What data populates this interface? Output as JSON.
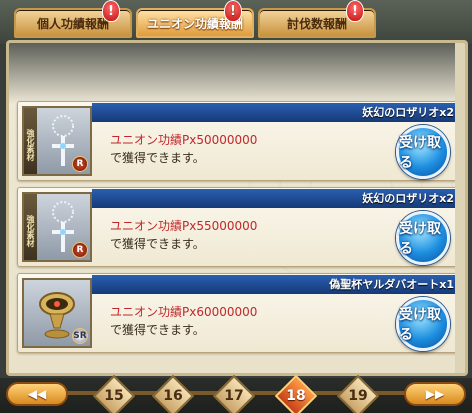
{
  "tabs": [
    {
      "label": "個人功績報酬",
      "active": false,
      "alert": true
    },
    {
      "label": "ユニオン功績報酬",
      "active": true,
      "alert": true
    },
    {
      "label": "討伐数報酬",
      "active": false,
      "alert": true
    }
  ],
  "alert_mark": "!",
  "rewards": [
    {
      "title": "妖幻のロザリオx2",
      "material_tag": "強化素材",
      "rarity": "R",
      "condition": "ユニオン功績Px50000000",
      "description": "で獲得できます。",
      "button": "受け取る",
      "icon": "rosary-icon"
    },
    {
      "title": "妖幻のロザリオx2",
      "material_tag": "強化素材",
      "rarity": "R",
      "condition": "ユニオン功績Px55000000",
      "description": "で獲得できます。",
      "button": "受け取る",
      "icon": "rosary-icon"
    },
    {
      "title": "偽聖杯ヤルダバオートx1",
      "material_tag": "",
      "rarity": "SR",
      "condition": "ユニオン功績Px60000000",
      "description": "で獲得できます。",
      "button": "受け取る",
      "icon": "chalice-icon"
    }
  ],
  "pager": {
    "prev": "◀◀",
    "next": "▶▶",
    "pages": [
      "15",
      "16",
      "17",
      "18",
      "19"
    ],
    "current": "18"
  },
  "colors": {
    "accent_blue": "#1d8ee0",
    "reward_red": "#c0282a",
    "tab_gold": "#e09b3c"
  }
}
